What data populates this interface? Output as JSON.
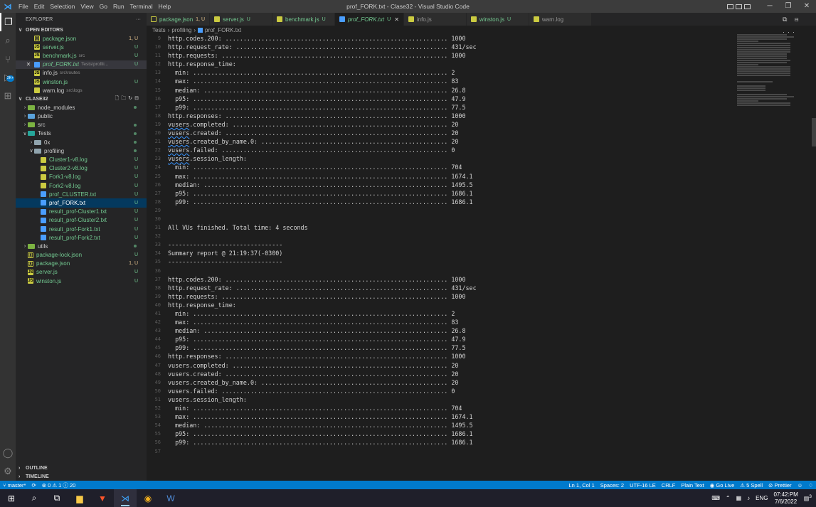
{
  "window": {
    "title": "prof_FORK.txt - Clase32 - Visual Studio Code",
    "menu": [
      "File",
      "Edit",
      "Selection",
      "View",
      "Go",
      "Run",
      "Terminal",
      "Help"
    ]
  },
  "activity": {
    "badge": "2K+"
  },
  "sidebar": {
    "header": "EXPLORER",
    "open_editors_label": "OPEN EDITORS",
    "open_editors": [
      {
        "name": "package.json",
        "hint": "",
        "status": "1, U",
        "icon": "json"
      },
      {
        "name": "server.js",
        "hint": "",
        "status": "U",
        "icon": "js"
      },
      {
        "name": "benchmark.js",
        "hint": "src",
        "status": "U",
        "icon": "js"
      },
      {
        "name": "prof_FORK.txt",
        "hint": "Tests\\profili...",
        "status": "U",
        "icon": "txt"
      },
      {
        "name": "info.js",
        "hint": "src\\routes",
        "status": "",
        "icon": "js"
      },
      {
        "name": "winston.js",
        "hint": "",
        "status": "U",
        "icon": "js"
      },
      {
        "name": "warn.log",
        "hint": "src\\logs",
        "status": "",
        "icon": "log"
      }
    ],
    "workspace_label": "CLASE32",
    "tree": [
      {
        "name": "node_modules",
        "type": "folder",
        "color": "green",
        "indent": 1,
        "open": false,
        "status": "dot"
      },
      {
        "name": "public",
        "type": "folder",
        "color": "blue",
        "indent": 1,
        "open": false,
        "status": ""
      },
      {
        "name": "src",
        "type": "folder",
        "color": "green",
        "indent": 1,
        "open": false,
        "status": "dot"
      },
      {
        "name": "Tests",
        "type": "folder",
        "color": "teal",
        "indent": 1,
        "open": true,
        "status": "dot"
      },
      {
        "name": "0x",
        "type": "folder",
        "color": "gray",
        "indent": 2,
        "open": false,
        "status": "dot"
      },
      {
        "name": "profiling",
        "type": "folder",
        "color": "gray",
        "indent": 2,
        "open": true,
        "status": "dot"
      },
      {
        "name": "Cluster1-v8.log",
        "type": "log",
        "indent": 3,
        "status": "U"
      },
      {
        "name": "Cluster2-v8.log",
        "type": "log",
        "indent": 3,
        "status": "U"
      },
      {
        "name": "Fork1-v8.log",
        "type": "log",
        "indent": 3,
        "status": "U"
      },
      {
        "name": "Fork2-v8.log",
        "type": "log",
        "indent": 3,
        "status": "U"
      },
      {
        "name": "prof_CLUSTER.txt",
        "type": "txt",
        "indent": 3,
        "status": "U"
      },
      {
        "name": "prof_FORK.txt",
        "type": "txt",
        "indent": 3,
        "status": "U",
        "active": true
      },
      {
        "name": "result_prof-Cluster1.txt",
        "type": "txt",
        "indent": 3,
        "status": "U"
      },
      {
        "name": "result_prof-Cluster2.txt",
        "type": "txt",
        "indent": 3,
        "status": "U"
      },
      {
        "name": "result_prof-Fork1.txt",
        "type": "txt",
        "indent": 3,
        "status": "U"
      },
      {
        "name": "result_prof-Fork2.txt",
        "type": "txt",
        "indent": 3,
        "status": "U"
      },
      {
        "name": "utils",
        "type": "folder",
        "color": "green",
        "indent": 1,
        "open": false,
        "status": "dot"
      },
      {
        "name": "package-lock.json",
        "type": "json",
        "indent": 1,
        "status": "U"
      },
      {
        "name": "package.json",
        "type": "json",
        "indent": 1,
        "status": "1, U"
      },
      {
        "name": "server.js",
        "type": "js",
        "indent": 1,
        "status": "U"
      },
      {
        "name": "winston.js",
        "type": "js",
        "indent": 1,
        "status": "U"
      }
    ],
    "outline_label": "OUTLINE",
    "timeline_label": "TIMELINE"
  },
  "tabs": [
    {
      "name": "package.json",
      "status": "1, U",
      "icon": "json",
      "active": false
    },
    {
      "name": "server.js",
      "status": "U",
      "icon": "js",
      "active": false
    },
    {
      "name": "benchmark.js",
      "status": "U",
      "icon": "js",
      "active": false
    },
    {
      "name": "prof_FORK.txt",
      "status": "U",
      "icon": "txt",
      "active": true
    },
    {
      "name": "info.js",
      "status": "",
      "icon": "js",
      "active": false
    },
    {
      "name": "winston.js",
      "status": "U",
      "icon": "js",
      "active": false
    },
    {
      "name": "warn.log",
      "status": "",
      "icon": "log",
      "active": false
    }
  ],
  "breadcrumb": [
    "Tests",
    "profiling",
    "prof_FORK.txt"
  ],
  "editor": {
    "lines": [
      {
        "n": 9,
        "t": "http.codes.200: .............................................................. 1000"
      },
      {
        "n": 10,
        "t": "http.request_rate: ........................................................... 431/sec"
      },
      {
        "n": 11,
        "t": "http.requests: ............................................................... 1000"
      },
      {
        "n": 12,
        "t": "http.response_time:"
      },
      {
        "n": 13,
        "t": "  min: ....................................................................... 2"
      },
      {
        "n": 14,
        "t": "  max: ....................................................................... 83"
      },
      {
        "n": 15,
        "t": "  median: .................................................................... 26.8"
      },
      {
        "n": 16,
        "t": "  p95: ....................................................................... 47.9"
      },
      {
        "n": 17,
        "t": "  p99: ....................................................................... 77.5"
      },
      {
        "n": 18,
        "t": "http.responses: .............................................................. 1000"
      },
      {
        "n": 19,
        "t": "vusers.completed: ............................................................ 20",
        "sq": true
      },
      {
        "n": 20,
        "t": "vusers.created: .............................................................. 20",
        "sq": true
      },
      {
        "n": 21,
        "t": "vusers.created_by_name.0: .................................................... 20",
        "sq": true
      },
      {
        "n": 22,
        "t": "vusers.failed: ............................................................... 0",
        "sq": true
      },
      {
        "n": 23,
        "t": "vusers.session_length:",
        "sq": true
      },
      {
        "n": 24,
        "t": "  min: ....................................................................... 704"
      },
      {
        "n": 25,
        "t": "  max: ....................................................................... 1674.1"
      },
      {
        "n": 26,
        "t": "  median: .................................................................... 1495.5"
      },
      {
        "n": 27,
        "t": "  p95: ....................................................................... 1686.1"
      },
      {
        "n": 28,
        "t": "  p99: ....................................................................... 1686.1"
      },
      {
        "n": 29,
        "t": ""
      },
      {
        "n": 30,
        "t": ""
      },
      {
        "n": 31,
        "t": "All VUs finished. Total time: 4 seconds"
      },
      {
        "n": 32,
        "t": ""
      },
      {
        "n": 33,
        "t": "--------------------------------"
      },
      {
        "n": 34,
        "t": "Summary report @ 21:19:37(-0300)"
      },
      {
        "n": 35,
        "t": "--------------------------------"
      },
      {
        "n": 36,
        "t": ""
      },
      {
        "n": 37,
        "t": "http.codes.200: .............................................................. 1000"
      },
      {
        "n": 38,
        "t": "http.request_rate: ........................................................... 431/sec"
      },
      {
        "n": 39,
        "t": "http.requests: ............................................................... 1000"
      },
      {
        "n": 40,
        "t": "http.response_time:"
      },
      {
        "n": 41,
        "t": "  min: ....................................................................... 2"
      },
      {
        "n": 42,
        "t": "  max: ....................................................................... 83"
      },
      {
        "n": 43,
        "t": "  median: .................................................................... 26.8"
      },
      {
        "n": 44,
        "t": "  p95: ....................................................................... 47.9"
      },
      {
        "n": 45,
        "t": "  p99: ....................................................................... 77.5"
      },
      {
        "n": 46,
        "t": "http.responses: .............................................................. 1000"
      },
      {
        "n": 47,
        "t": "vusers.completed: ............................................................ 20"
      },
      {
        "n": 48,
        "t": "vusers.created: .............................................................. 20"
      },
      {
        "n": 49,
        "t": "vusers.created_by_name.0: .................................................... 20"
      },
      {
        "n": 50,
        "t": "vusers.failed: ............................................................... 0"
      },
      {
        "n": 51,
        "t": "vusers.session_length:"
      },
      {
        "n": 52,
        "t": "  min: ....................................................................... 704"
      },
      {
        "n": 53,
        "t": "  max: ....................................................................... 1674.1"
      },
      {
        "n": 54,
        "t": "  median: .................................................................... 1495.5"
      },
      {
        "n": 55,
        "t": "  p95: ....................................................................... 1686.1"
      },
      {
        "n": 56,
        "t": "  p99: ....................................................................... 1686.1"
      },
      {
        "n": 57,
        "t": ""
      }
    ]
  },
  "statusbar": {
    "branch": "master*",
    "problems": "⊗ 0 ⚠ 1 ⓘ 20",
    "cursor": "Ln 1, Col 1",
    "spaces": "Spaces: 2",
    "encoding": "UTF-16 LE",
    "eol": "CRLF",
    "language": "Plain Text",
    "golive": "Go Live",
    "spell": "5 Spell",
    "prettier": "Prettier"
  },
  "taskbar": {
    "lang": "ENG",
    "time": "07:42:PM",
    "date": "7/6/2022",
    "notif_count": "3"
  },
  "colors": {
    "accent": "#007acc",
    "untracked": "#73c991",
    "modified": "#e2c08d"
  }
}
